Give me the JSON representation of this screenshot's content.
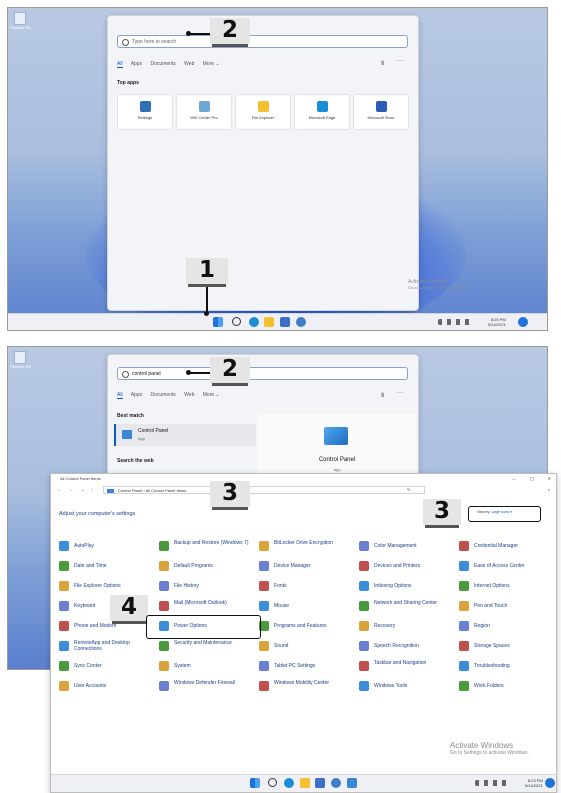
{
  "step_numbers": {
    "one": "1",
    "two": "2",
    "three": "3",
    "four": "4"
  },
  "desktop": {
    "recycle_bin_label": "Recycle Bin"
  },
  "start_menu": {
    "search_placeholder": "Type here to search",
    "tabs": [
      "All",
      "Apps",
      "Documents",
      "Web",
      "More ⌄"
    ],
    "top_apps_heading": "Top apps",
    "apps": [
      {
        "label": "Settings",
        "icon": "gear-icon",
        "color": "#2f6fb3"
      },
      {
        "label": "MSI Center Pro",
        "icon": "msi-icon",
        "color": "#6fa7d8"
      },
      {
        "label": "File Explorer",
        "icon": "folder-icon",
        "color": "#f3c12f"
      },
      {
        "label": "Microsoft Edge",
        "icon": "edge-icon",
        "color": "#1b8dd6"
      },
      {
        "label": "Microsoft Store",
        "icon": "store-icon",
        "color": "#2c5cb6"
      }
    ]
  },
  "watermark": {
    "title": "Activate Windows",
    "subtitle": "Go to Settings to activate Windows."
  },
  "tray": {
    "time": "8:20 PM",
    "date": "5/14/2021",
    "time2": "8:23 PM",
    "date2": "5/14/2021"
  },
  "search2": {
    "query": "control panel",
    "tabs": [
      "All",
      "Apps",
      "Documents",
      "Web",
      "More ⌄"
    ],
    "best_match_heading": "Best match",
    "best_match_title": "Control Panel",
    "best_match_type": "App",
    "search_web_heading": "Search the web",
    "preview_title": "Control Panel",
    "preview_type": "App"
  },
  "control_panel": {
    "window_title": "All Control Panel Items",
    "breadcrumb": "Control Panel  ›  All Control Panel Items",
    "heading": "Adjust your computer's settings",
    "view_by_label": "View by:",
    "view_by_value": "Large icons ▾",
    "items": [
      [
        "AutoPlay",
        "Backup and Restore (Windows 7)",
        "BitLocker Drive Encryption",
        "Color Management",
        "Credential Manager"
      ],
      [
        "Date and Time",
        "Default Programs",
        "Device Manager",
        "Devices and Printers",
        "Ease of Access Center"
      ],
      [
        "File Explorer Options",
        "File History",
        "Fonts",
        "Indexing Options",
        "Internet Options"
      ],
      [
        "Keyboard",
        "Mail (Microsoft Outlook)",
        "Mouse",
        "Network and Sharing Center",
        "Pen and Touch"
      ],
      [
        "Phone and Modem",
        "Power Options",
        "Programs and Features",
        "Recovery",
        "Region"
      ],
      [
        "RemoteApp and Desktop Connections",
        "Security and Maintenance",
        "Sound",
        "Speech Recognition",
        "Storage Spaces"
      ],
      [
        "Sync Center",
        "System",
        "Tablet PC Settings",
        "Taskbar and Navigation",
        "Troubleshooting"
      ],
      [
        "User Accounts",
        "Windows Defender Firewall",
        "Windows Mobility Center",
        "Windows Tools",
        "Work Folders"
      ]
    ],
    "icon_colors": [
      "#3c8dd9",
      "#4a9a3c",
      "#d9a23a",
      "#6a7fd1",
      "#c0504d"
    ]
  }
}
